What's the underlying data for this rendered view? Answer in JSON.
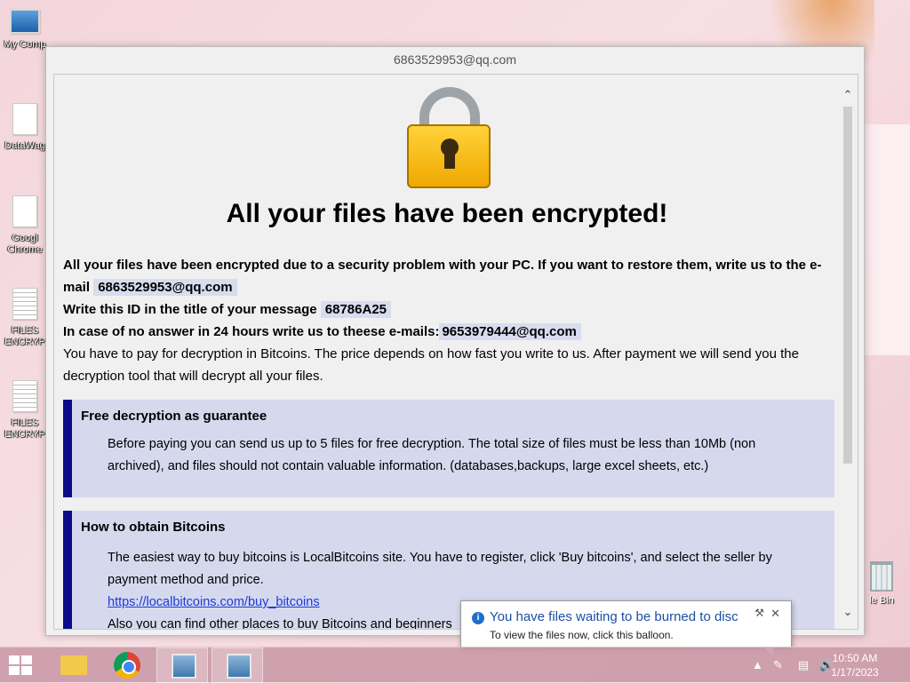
{
  "desktop": {
    "icons": [
      {
        "label": "My Comp"
      },
      {
        "label": "DataWag"
      },
      {
        "label": "Googl Chrome"
      },
      {
        "label": "FILES ENCRYP"
      },
      {
        "label": "FILES ENCRYP"
      }
    ],
    "recycle_bin": "le Bin"
  },
  "window": {
    "title": "6863529953@qq.com",
    "headline": "All your files have been encrypted!",
    "intro_bold": "All your files have been encrypted due to a security problem with your PC. If you want to restore them, write us to the e-mail",
    "email_primary": "6863529953@qq.com",
    "id_label": "Write this ID in the title of your message",
    "id_value": "68786A25",
    "noanswer_label": "In case of no answer in 24 hours write us to theese e-mails:",
    "email_secondary": "9653979444@qq.com",
    "pay_text": "You have to pay for decryption in Bitcoins. The price depends on how fast you write to us. After payment we will send you the decryption tool that will decrypt all your files.",
    "box1": {
      "title": "Free decryption as guarantee",
      "text": "Before paying you can send us up to 5 files for free decryption. The total size of files must be less than 10Mb (non archived), and files should not contain valuable information. (databases,backups, large excel sheets, etc.)"
    },
    "box2": {
      "title": "How to obtain Bitcoins",
      "text": "The easiest way to buy bitcoins is LocalBitcoins site. You have to register, click 'Buy bitcoins', and select the seller by payment method and price.",
      "link": "https://localbitcoins.com/buy_bitcoins",
      "text2": "Also you can find other places to buy Bitcoins and beginners"
    }
  },
  "balloon": {
    "title": "You have files waiting to be burned to disc",
    "text": "To view the files now, click this balloon."
  },
  "taskbar": {
    "time": "10:50 AM",
    "date": "1/17/2023"
  }
}
